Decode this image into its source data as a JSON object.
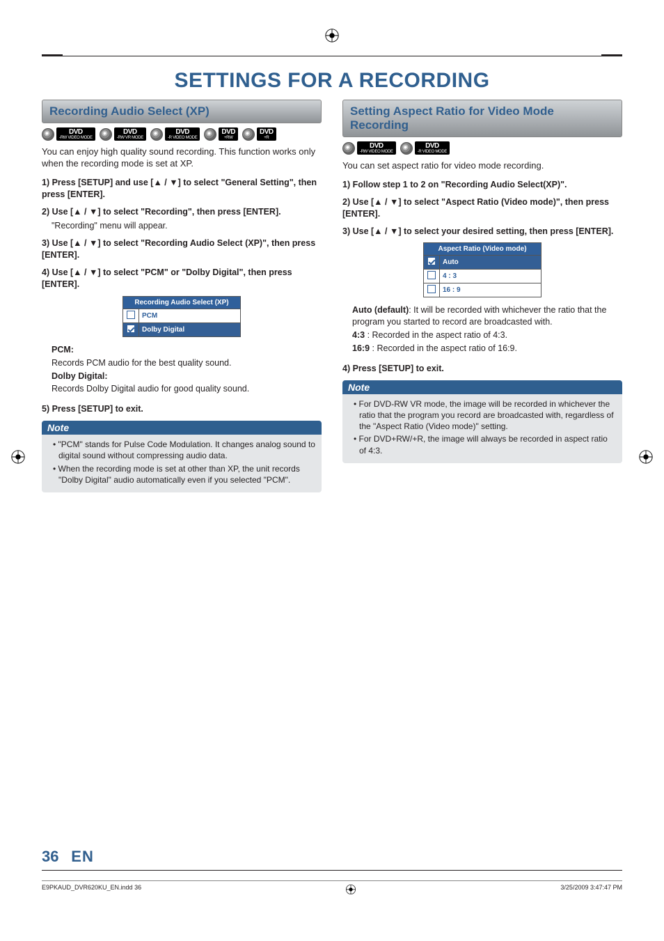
{
  "title": "SETTINGS FOR A RECORDING",
  "left": {
    "section_title": "Recording Audio Select (XP)",
    "badges": [
      {
        "top": "DVD",
        "bot": "-RW VIDEO MODE"
      },
      {
        "top": "DVD",
        "bot": "-RW VR MODE"
      },
      {
        "top": "DVD",
        "bot": "-R VIDEO MODE"
      },
      {
        "top": "DVD",
        "bot": "+RW"
      },
      {
        "top": "DVD",
        "bot": "+R"
      }
    ],
    "intro": "You can enjoy high quality sound recording. This function works only when the recording mode is set at XP.",
    "step1": "1) Press [SETUP] and use [▲ / ▼] to select \"General Setting\", then press [ENTER].",
    "step2": "2) Use [▲ / ▼] to select \"Recording\", then press [ENTER].",
    "step2_sub": "\"Recording\" menu will appear.",
    "step3": "3) Use [▲ / ▼] to select \"Recording Audio Select (XP)\", then press [ENTER].",
    "step4": "4) Use [▲ / ▼] to select \"PCM\" or \"Dolby Digital\", then press [ENTER].",
    "menu": {
      "header": "Recording Audio Select (XP)",
      "rows": [
        {
          "checked": false,
          "label": "PCM",
          "selected": false
        },
        {
          "checked": true,
          "label": "Dolby Digital",
          "selected": true
        }
      ]
    },
    "pcm_label": "PCM:",
    "pcm_desc": "Records PCM audio for the best quality sound.",
    "dolby_label": "Dolby Digital:",
    "dolby_desc": "Records Dolby Digital audio for good quality sound.",
    "step5": "5) Press [SETUP] to exit.",
    "note_title": "Note",
    "notes": [
      "\"PCM\" stands for Pulse Code Modulation. It changes analog sound to digital sound without compressing audio data.",
      "When the recording mode is set at other than XP, the unit records \"Dolby Digital\" audio automatically even if you selected \"PCM\"."
    ]
  },
  "right": {
    "section_title": "Setting Aspect Ratio for Video Mode Recording",
    "badges": [
      {
        "top": "DVD",
        "bot": "-RW VIDEO MODE"
      },
      {
        "top": "DVD",
        "bot": "-R VIDEO MODE"
      }
    ],
    "intro": "You can set aspect ratio for video mode recording.",
    "step1": "1) Follow step 1 to 2 on \"Recording Audio Select(XP)\".",
    "step2": "2) Use [▲ / ▼] to select \"Aspect Ratio (Video mode)\", then press [ENTER].",
    "step3": "3) Use [▲ / ▼] to select your desired setting, then press [ENTER].",
    "menu": {
      "header": "Aspect Ratio (Video mode)",
      "rows": [
        {
          "checked": true,
          "label": "Auto",
          "selected": true
        },
        {
          "checked": false,
          "label": "4 : 3",
          "selected": false
        },
        {
          "checked": false,
          "label": "16 : 9",
          "selected": false
        }
      ]
    },
    "auto_label": "Auto (default)",
    "auto_desc": ": It will be recorded with whichever the ratio that the program you started to record are broadcasted with.",
    "r43_label": "4:3",
    "r43_desc": ":    Recorded in the aspect ratio of 4:3.",
    "r169_label": "16:9",
    "r169_desc": ":  Recorded in the aspect ratio of 16:9.",
    "step4": "4) Press [SETUP] to exit.",
    "note_title": "Note",
    "notes": [
      "For DVD-RW VR mode, the image will be recorded in whichever the ratio that the program you record are broadcasted with, regardless of the \"Aspect Ratio (Video mode)\" setting.",
      "For DVD+RW/+R, the image will always be recorded in aspect ratio of 4:3."
    ]
  },
  "footer": {
    "page_num": "36",
    "lang": "EN",
    "file_ref": "E9PKAUD_DVR620KU_EN.indd   36",
    "timestamp": "3/25/2009   3:47:47 PM"
  }
}
